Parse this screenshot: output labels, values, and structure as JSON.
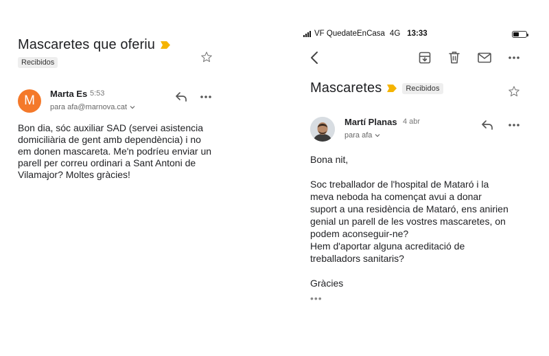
{
  "left_email": {
    "subject": "Mascaretes que oferiu",
    "folder_label": "Recibidos",
    "sender_initial": "M",
    "sender_name": "Marta Es",
    "time": "5:53",
    "recipient": "para afa@marnova.cat",
    "body": "Bon dia, sóc auxiliar SAD (servei asistencia\ndomiciliària de gent amb dependència) i no\nem donen mascareta. Me'n podríeu enviar un\nparell per correu ordinari a Sant Antoni de\nVilamajor? Moltes gràcies!",
    "avatar_color": "#f4792a"
  },
  "right_email": {
    "status_bar": {
      "carrier": "VF QuedateEnCasa",
      "network": "4G",
      "time": "13:33",
      "battery_level": 0.45
    },
    "subject": "Mascaretes",
    "folder_label": "Recibidos",
    "sender_name": "Martí Planas",
    "date": "4 abr",
    "recipient": "para afa",
    "body": "Bona nit,\n\nSoc treballador de l'hospital de Mataró i la\nmeva neboda ha començat avui a donar\nsuport a una residència de Mataró, ens anirien\ngenial un parell de les vostres mascaretes, on\npodem aconseguir-ne?\nHem d'aportar alguna acreditació de\ntreballadors sanitaris?\n\nGràcies",
    "trimmed_indicator": "•••"
  },
  "icons": {
    "importance_marker": "importance-tag-icon",
    "star": "star-icon",
    "reply": "reply-icon",
    "more": "more-horizontal-icon",
    "back": "back-arrow-icon",
    "archive": "archive-icon",
    "delete": "trash-icon",
    "mark_unread": "mail-icon"
  },
  "colors": {
    "importance_marker": "#f5b400",
    "accent_orange": "#f4792a"
  }
}
